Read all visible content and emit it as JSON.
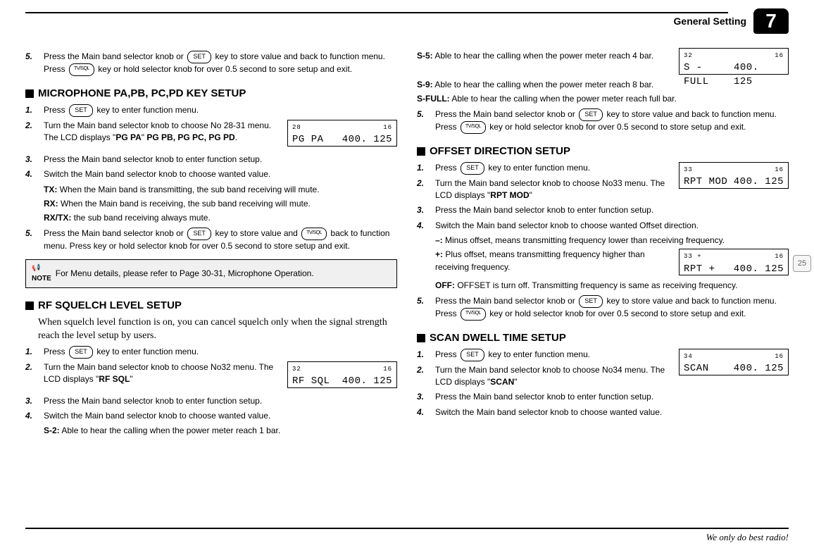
{
  "header": {
    "title": "General Setting",
    "chapter": "7"
  },
  "page": "25",
  "slogan": "We only do best radio!",
  "keys": {
    "set": "SET",
    "tvsql": "TV/SQL"
  },
  "lcd": {
    "pg": {
      "tl": "28",
      "tr": "16",
      "left": "PG  PA",
      "right": "400. 125",
      "br": ""
    },
    "rfsql": {
      "tl": "32",
      "tr": "16",
      "left": "RF  SQL",
      "right": "400. 125",
      "br": ""
    },
    "sfull": {
      "tl": "32",
      "tr": "16",
      "left": "S - FULL",
      "right": "400. 125",
      "br": ""
    },
    "rptmod": {
      "tl": "33",
      "tr": "16",
      "left": "RPT  MOD",
      "right": "400. 125",
      "br": ""
    },
    "rptplus": {
      "tl": "33     +",
      "tr": "16",
      "left": "RPT   +",
      "right": "400. 125",
      "br": ""
    },
    "scan": {
      "tl": "34",
      "tr": "16",
      "left": "SCAN",
      "right": "400. 125",
      "br": ""
    }
  },
  "left": {
    "i5": {
      "a": "5.",
      "b": "Press the Main band selector knob or ",
      "c": " key to store value and back to function menu. Press ",
      "d": " key or hold selector knob for over 0.5 second to sore setup and exit."
    },
    "mic": {
      "title": "MICROPHONE PA,PB, PC,PD KEY SETUP",
      "s1": {
        "a": "1.",
        "b": "Press ",
        "c": " key to enter function menu."
      },
      "s2": {
        "a": "2.",
        "b": "Turn the Main band selector knob to choose No 28-31 menu. The LCD displays \"",
        "c": "PG PA",
        "d": "\" ",
        "e": "PG PB,  PG PC, PG PD",
        "f": "."
      },
      "s3": {
        "a": "3.",
        "b": "Press the Main band selector knob to enter function setup."
      },
      "s4": {
        "a": "4.",
        "b": "Switch the Main band selector knob to choose wanted value."
      },
      "tx": {
        "a": "TX:",
        "b": " When the Main band is transmitting, the sub band receiving will mute."
      },
      "rx": {
        "a": "RX:",
        "b": " When the Main band is receiving, the sub band receiving will mute."
      },
      "rxtx": {
        "a": "RX/TX:",
        "b": " the sub band receiving always mute."
      },
      "s5": {
        "a": "5.",
        "b": "Press the Main band selector knob or ",
        "c": " key to store value and ",
        "d": " back to function menu. Press key or hold selector knob for over 0.5 second to store setup and exit."
      },
      "note": "For Menu details, please refer to Page 30-31, Microphone Operation."
    },
    "rf": {
      "title": "RF SQUELCH LEVEL SETUP",
      "intro": "When squelch level function is on, you can cancel squelch only when the signal strength reach the level setup by users.",
      "s1": {
        "a": "1.",
        "b": "Press ",
        "c": " key to enter function menu."
      },
      "s2": {
        "a": "2.",
        "b": "Turn the Main band selector knob to choose No32 menu. The LCD displays \"",
        "c": "RF SQL",
        "d": "\""
      },
      "s3": {
        "a": "3.",
        "b": "Press the Main band selector knob to enter function setup."
      },
      "s4": {
        "a": "4.",
        "b": "Switch the Main band selector knob to choose wanted value."
      },
      "s2l": {
        "a": "S-2:",
        "b": " Able to hear the calling when the power meter reach 1 bar."
      }
    }
  },
  "right": {
    "sq": {
      "s5": {
        "a": "S-5:",
        "b": " Able to hear the calling when the power meter reach 4 bar."
      },
      "s9": {
        "a": "S-9:",
        "b": " Able to hear the calling when the power meter reach 8 bar."
      },
      "sfull": {
        "a": "S-FULL:",
        "b": " Able to hear the calling when the power meter reach full bar."
      },
      "step5": {
        "a": "5.",
        "b": "Press the Main band selector knob or ",
        "c": " key to store value  and back to function menu. Press ",
        "d": " key or hold selector knob for over 0.5 second to store setup and exit."
      }
    },
    "off": {
      "title": "OFFSET DIRECTION SETUP",
      "s1": {
        "a": "1.",
        "b": "Press ",
        "c": " key to enter function menu."
      },
      "s2": {
        "a": "2.",
        "b": "Turn the Main band selector knob to choose No33 menu. The LCD displays \"",
        "c": "RPT MOD",
        "d": "\""
      },
      "s3": {
        "a": "3.",
        "b": "Press the Main band selector knob to enter function setup."
      },
      "s4": {
        "a": "4.",
        "b": "Switch the Main band selector knob to choose wanted Offset direction."
      },
      "minus": {
        "a": "–:",
        "b": "  Minus offset, means transmitting frequency lower than receiving frequency."
      },
      "plus": {
        "a": "+:",
        "b": " Plus offset, means transmitting frequency higher than receiving frequency."
      },
      "offl": {
        "a": "OFF:",
        "b": "  OFFSET is turn off. Transmitting frequency is same as receiving frequency."
      },
      "s5": {
        "a": "5.",
        "b": "Press the Main band selector knob or ",
        "c": " key to store value and back to function menu. Press ",
        "d": " key or hold selector knob for over 0.5 second to store setup and exit."
      }
    },
    "scan": {
      "title": "SCAN DWELL TIME SETUP",
      "s1": {
        "a": "1.",
        "b": "Press ",
        "c": " key to enter function menu."
      },
      "s2": {
        "a": "2.",
        "b": "Turn the Main band selector knob to choose No34 menu. The LCD displays \"",
        "c": "SCAN",
        "d": "\""
      },
      "s3": {
        "a": "3.",
        "b": "Press the Main band selector knob to enter function setup."
      },
      "s4": {
        "a": "4.",
        "b": "Switch the Main band selector knob to choose wanted value."
      }
    }
  }
}
